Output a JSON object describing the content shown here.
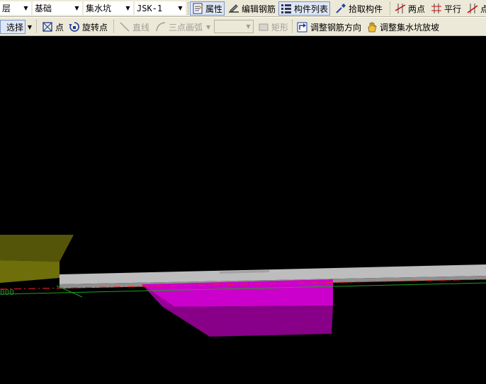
{
  "toolbar1": {
    "floor_combo": {
      "value": "层"
    },
    "category_combo": {
      "value": "基础"
    },
    "type_combo": {
      "value": "集水坑"
    },
    "member_combo": {
      "value": "JSK-1"
    },
    "properties_label": "属性",
    "edit_rebar_label": "编辑钢筋",
    "member_list_label": "构件列表",
    "pick_member_label": "拾取构件",
    "two_points_label": "两点",
    "parallel_label": "平行",
    "point_angle_label": "点"
  },
  "toolbar2": {
    "select_label": "选择",
    "point_label": "点",
    "rotate_point_label": "旋转点",
    "line_label": "直线",
    "arc_label": "三点画弧",
    "shape_combo": {
      "value": ""
    },
    "rect_label": "矩形",
    "adjust_rebar_dir_label": "调整钢筋方向",
    "adjust_pit_slope_label": "调整集水坑放坡"
  },
  "viewport": {
    "axis_text": "000",
    "colors": {
      "background": "#000000",
      "pit_fill": "#cc00cc",
      "pit_side": "#990099",
      "pit_bottom": "#770077",
      "slab": "#bdbdbd",
      "footing": "#6b6b00",
      "axis_red": "#ff2020",
      "axis_green": "#20a020"
    }
  }
}
